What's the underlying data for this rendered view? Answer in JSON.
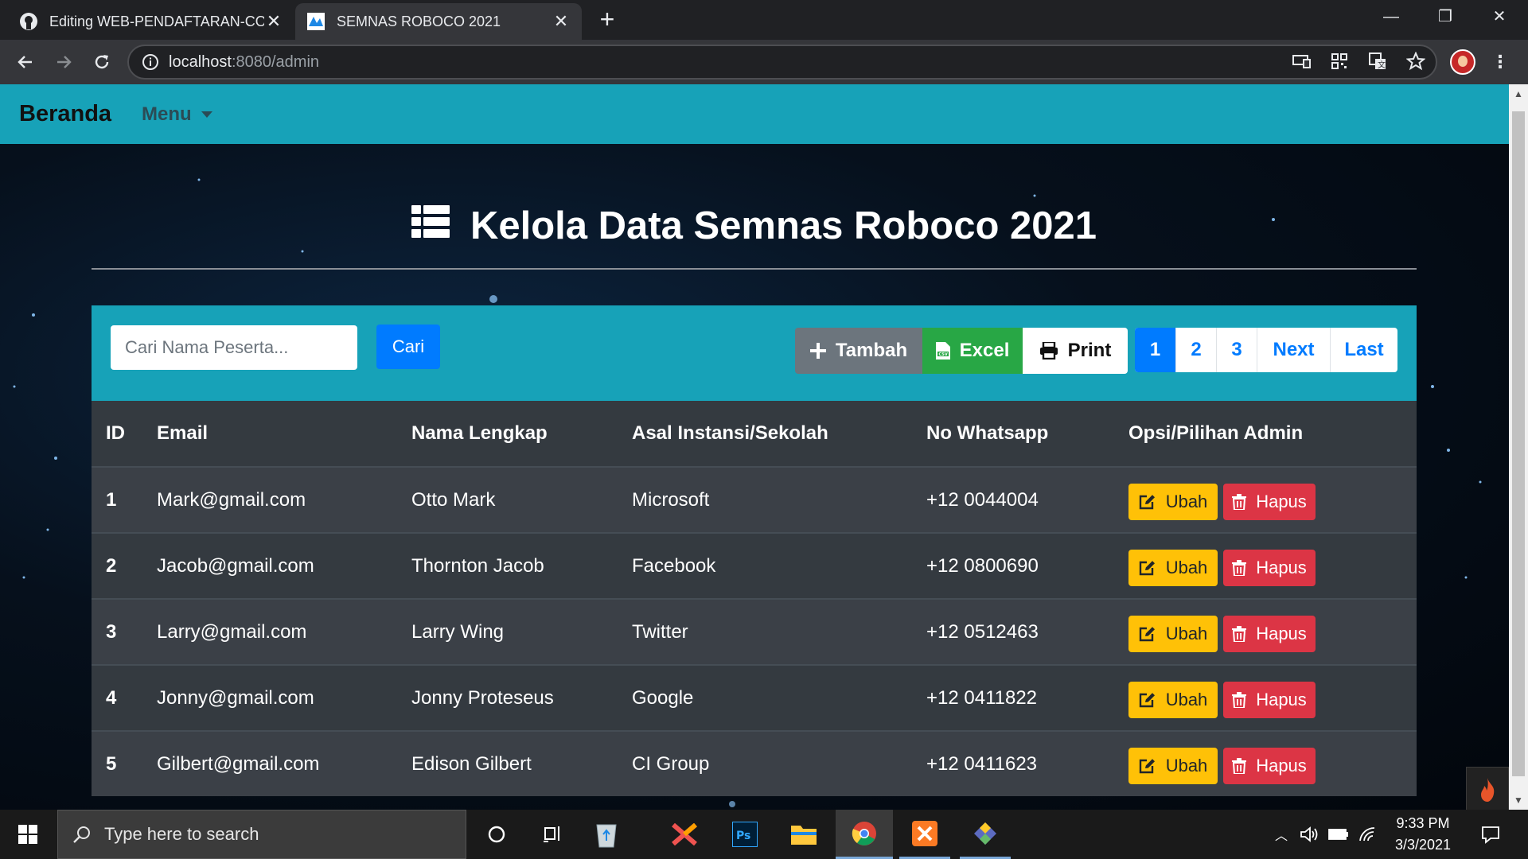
{
  "browser": {
    "tabs": [
      {
        "title": "Editing WEB-PENDAFTARAN-CODEIGNITER",
        "close": "✕"
      },
      {
        "title": "SEMNAS ROBOCO 2021",
        "close": "✕"
      }
    ],
    "new_tab": "+",
    "url_host": "localhost",
    "url_rest": ":8080/admin"
  },
  "navbar": {
    "brand": "Beranda",
    "menu": "Menu"
  },
  "page": {
    "title": "Kelola Data Semnas Roboco 2021"
  },
  "controls": {
    "search_placeholder": "Cari Nama Peserta...",
    "search_button": "Cari",
    "tambah": "Tambah",
    "excel": "Excel",
    "print": "Print",
    "pages": [
      "1",
      "2",
      "3",
      "Next",
      "Last"
    ]
  },
  "table": {
    "headers": [
      "ID",
      "Email",
      "Nama Lengkap",
      "Asal Instansi/Sekolah",
      "No Whatsapp",
      "Opsi/Pilihan Admin"
    ],
    "rows": [
      {
        "id": "1",
        "email": "Mark@gmail.com",
        "nama": "Otto Mark",
        "instansi": "Microsoft",
        "wa": "+12 0044004"
      },
      {
        "id": "2",
        "email": "Jacob@gmail.com",
        "nama": "Thornton Jacob",
        "instansi": "Facebook",
        "wa": "+12 0800690"
      },
      {
        "id": "3",
        "email": "Larry@gmail.com",
        "nama": "Larry Wing",
        "instansi": "Twitter",
        "wa": "+12 0512463"
      },
      {
        "id": "4",
        "email": "Jonny@gmail.com",
        "nama": "Jonny Proteseus",
        "instansi": "Google",
        "wa": "+12 0411822"
      },
      {
        "id": "5",
        "email": "Gilbert@gmail.com",
        "nama": "Edison Gilbert",
        "instansi": "CI Group",
        "wa": "+12 0411623"
      }
    ],
    "ubah": "Ubah",
    "hapus": "Hapus"
  },
  "taskbar": {
    "search_placeholder": "Type here to search",
    "time": "9:33 PM",
    "date": "3/3/2021"
  },
  "colors": {
    "accent": "#17a2b8",
    "primary": "#007bff",
    "success": "#28a745",
    "warning": "#ffc107",
    "danger": "#dc3545",
    "secondary": "#6c757d"
  },
  "icons": [
    "github-icon",
    "site-favicon",
    "back-icon",
    "forward-icon",
    "reload-icon",
    "info-icon",
    "cast-icon",
    "qr-icon",
    "translate-icon",
    "star-icon",
    "list-icon",
    "plus-icon",
    "csv-icon",
    "printer-icon",
    "edit-icon",
    "trash-icon",
    "flame-icon",
    "windows-icon",
    "search-icon",
    "cortana-icon",
    "task-view-icon",
    "recycle-bin-icon",
    "xampp-x-icon",
    "photoshop-icon",
    "file-explorer-icon",
    "chrome-icon",
    "xampp-icon",
    "git-icon"
  ]
}
